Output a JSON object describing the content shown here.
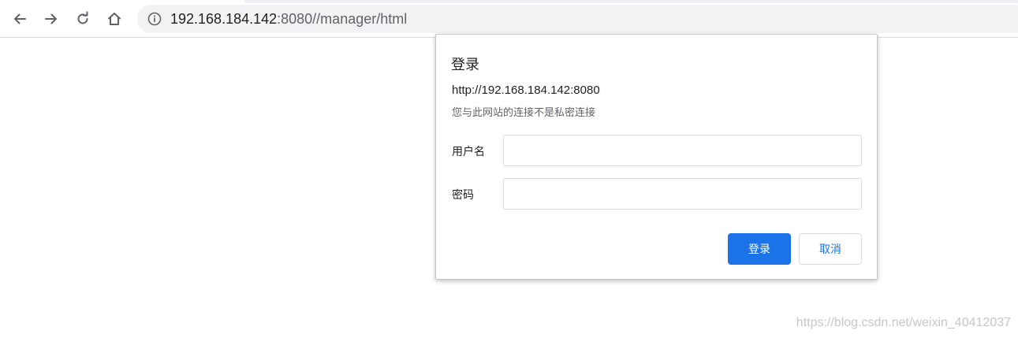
{
  "browser": {
    "url_host": "192.168.184.142",
    "url_rest": ":8080//manager/html"
  },
  "dialog": {
    "title": "登录",
    "origin": "http://192.168.184.142:8080",
    "warning": "您与此网站的连接不是私密连接",
    "username_label": "用户名",
    "username_value": "",
    "password_label": "密码",
    "password_value": "",
    "login_button": "登录",
    "cancel_button": "取消"
  },
  "watermark": "https://blog.csdn.net/weixin_40412037",
  "colors": {
    "accent": "#1a73e8",
    "omnibox_bg": "#f1f3f4"
  },
  "icons": [
    "back-arrow-icon",
    "forward-arrow-icon",
    "reload-icon",
    "home-icon",
    "info-icon"
  ]
}
